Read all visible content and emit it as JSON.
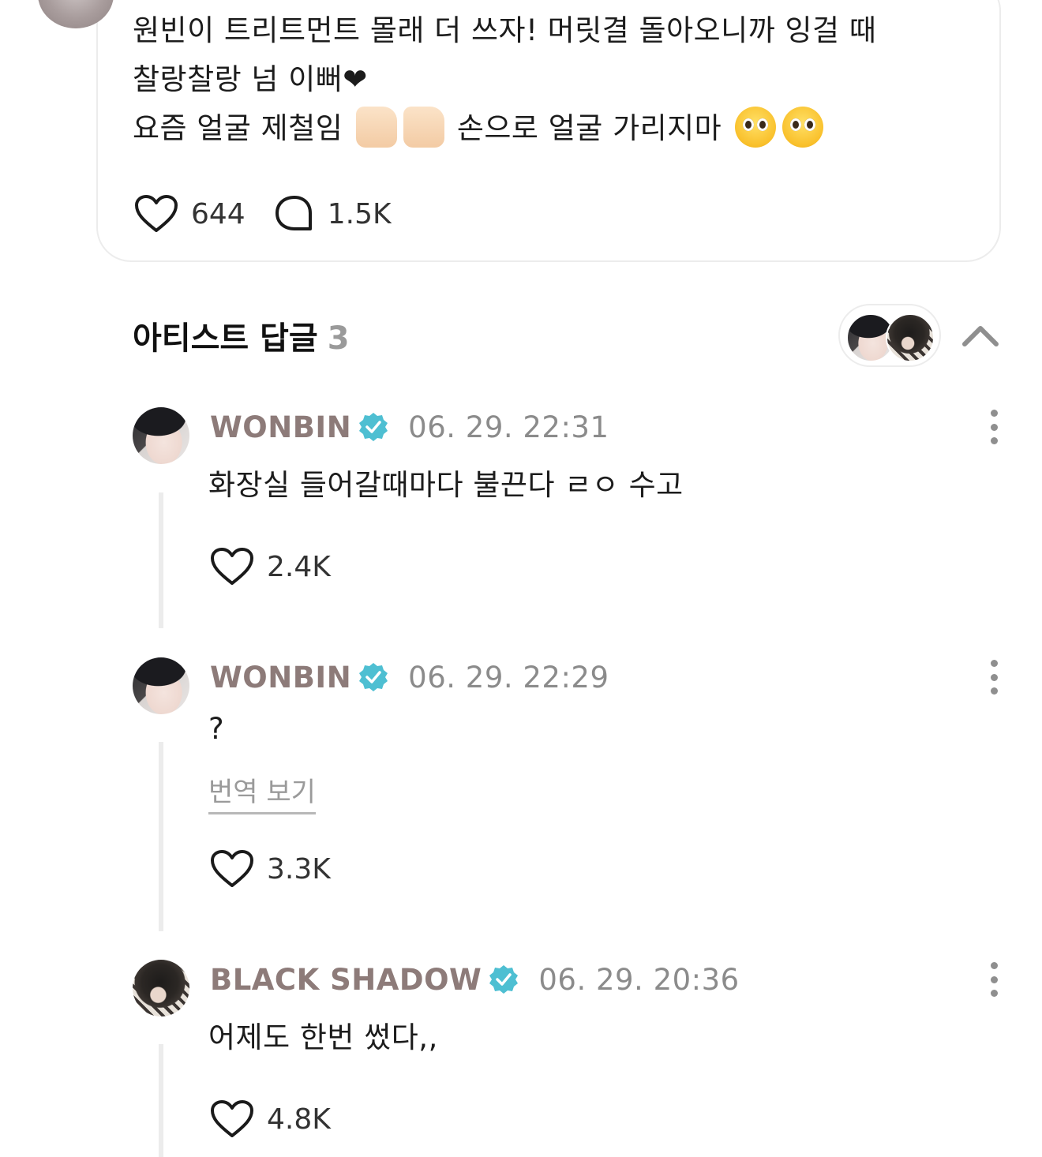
{
  "post": {
    "lines": [
      "원빈이 트리트먼트 몰래 더 쓰자! 머릿결 돌아오니까 잉걸 때",
      "찰랑찰랑 넘 이뻐❤",
      "요즘 얼굴 제철임",
      "손으로 얼굴 가리지마"
    ],
    "like_count": "644",
    "comment_count": "1.5K"
  },
  "artist_replies": {
    "title": "아티스트 답글",
    "count": "3"
  },
  "replies": [
    {
      "name": "WONBIN",
      "time": "06. 29. 22:31",
      "text": "화장실 들어갈때마다 불끈다 ㄹㅇ 수고",
      "likes": "2.4K"
    },
    {
      "name": "WONBIN",
      "time": "06. 29. 22:29",
      "text": "?",
      "translate": "번역 보기",
      "likes": "3.3K"
    },
    {
      "name": "BLACK SHADOW",
      "time": "06. 29. 20:36",
      "text": "어제도 한번 썼다,,",
      "likes": "4.8K"
    }
  ],
  "colors": {
    "accent_name": "#8d7b79",
    "verified": "#4ebfd2",
    "muted": "#8b8b8b"
  },
  "icons": [
    "heart-icon",
    "comment-bubble-icon",
    "verified-badge-icon",
    "chevron-up-icon",
    "more-vertical-icon",
    "thumbs-up-icon",
    "pleading-face-icon"
  ]
}
